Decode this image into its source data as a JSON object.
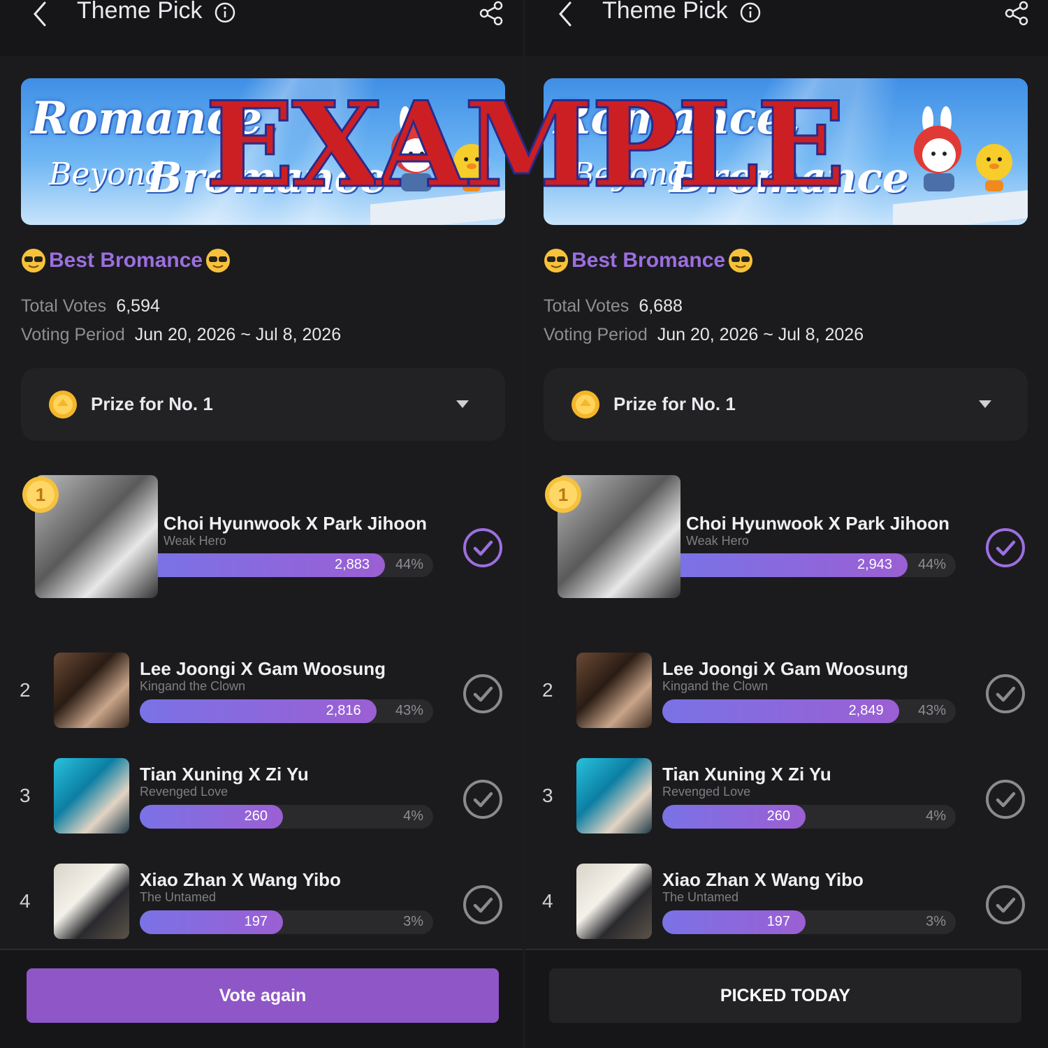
{
  "panels": [
    {
      "topbar": {
        "title": "Theme Pick"
      },
      "banner": {
        "line1": "Romance,",
        "line2": "Beyond",
        "line3": "Bromance"
      },
      "section_title": "Best Bromance",
      "total_votes": {
        "label": "Total Votes",
        "value": "6,594"
      },
      "voting_period": {
        "label": "Voting Period",
        "value": "Jun 20, 2026 ~ Jul 8, 2026"
      },
      "prize": {
        "label": "Prize for No. 1"
      },
      "rank1": {
        "badge": "1",
        "name": "Choi Hyunwook X Park Jihoon",
        "show": "Weak Hero",
        "votes": "2,883",
        "pct": "44%",
        "share": 0.44
      },
      "candidates": [
        {
          "rank": "2",
          "name": "Lee Joongi X Gam Woosung",
          "show": "Kingand the Clown",
          "votes": "2,816",
          "pct": "43%",
          "share": 0.43
        },
        {
          "rank": "3",
          "name": "Tian Xuning X Zi Yu",
          "show": "Revenged Love",
          "votes": "260",
          "pct": "4%",
          "share": 0.04
        },
        {
          "rank": "4",
          "name": "Xiao Zhan X Wang Yibo",
          "show": "The Untamed",
          "votes": "197",
          "pct": "3%",
          "share": 0.03
        }
      ],
      "button": "Vote again"
    },
    {
      "topbar": {
        "title": "Theme Pick"
      },
      "banner": {
        "line1": "Romance,",
        "line2": "Beyond",
        "line3": "Bromance"
      },
      "section_title": "Best Bromance",
      "total_votes": {
        "label": "Total Votes",
        "value": "6,688"
      },
      "voting_period": {
        "label": "Voting Period",
        "value": "Jun 20, 2026 ~ Jul 8, 2026"
      },
      "prize": {
        "label": "Prize for No. 1"
      },
      "rank1": {
        "badge": "1",
        "name": "Choi Hyunwook X Park Jihoon",
        "show": "Weak Hero",
        "votes": "2,943",
        "pct": "44%",
        "share": 0.44
      },
      "candidates": [
        {
          "rank": "2",
          "name": "Lee Joongi X Gam Woosung",
          "show": "Kingand the Clown",
          "votes": "2,849",
          "pct": "43%",
          "share": 0.43
        },
        {
          "rank": "3",
          "name": "Tian Xuning X Zi Yu",
          "show": "Revenged Love",
          "votes": "260",
          "pct": "4%",
          "share": 0.04
        },
        {
          "rank": "4",
          "name": "Xiao Zhan X Wang Yibo",
          "show": "The Untamed",
          "votes": "197",
          "pct": "3%",
          "share": 0.03
        }
      ],
      "button": "PICKED TODAY"
    }
  ],
  "watermark": "EXAMPLE",
  "colors": {
    "accent": "#9c6fe0",
    "button_vote": "#8f56c7",
    "bar_start": "#7a72e6",
    "bar_end": "#9b5fd3",
    "watermark": "#cc1f24"
  }
}
